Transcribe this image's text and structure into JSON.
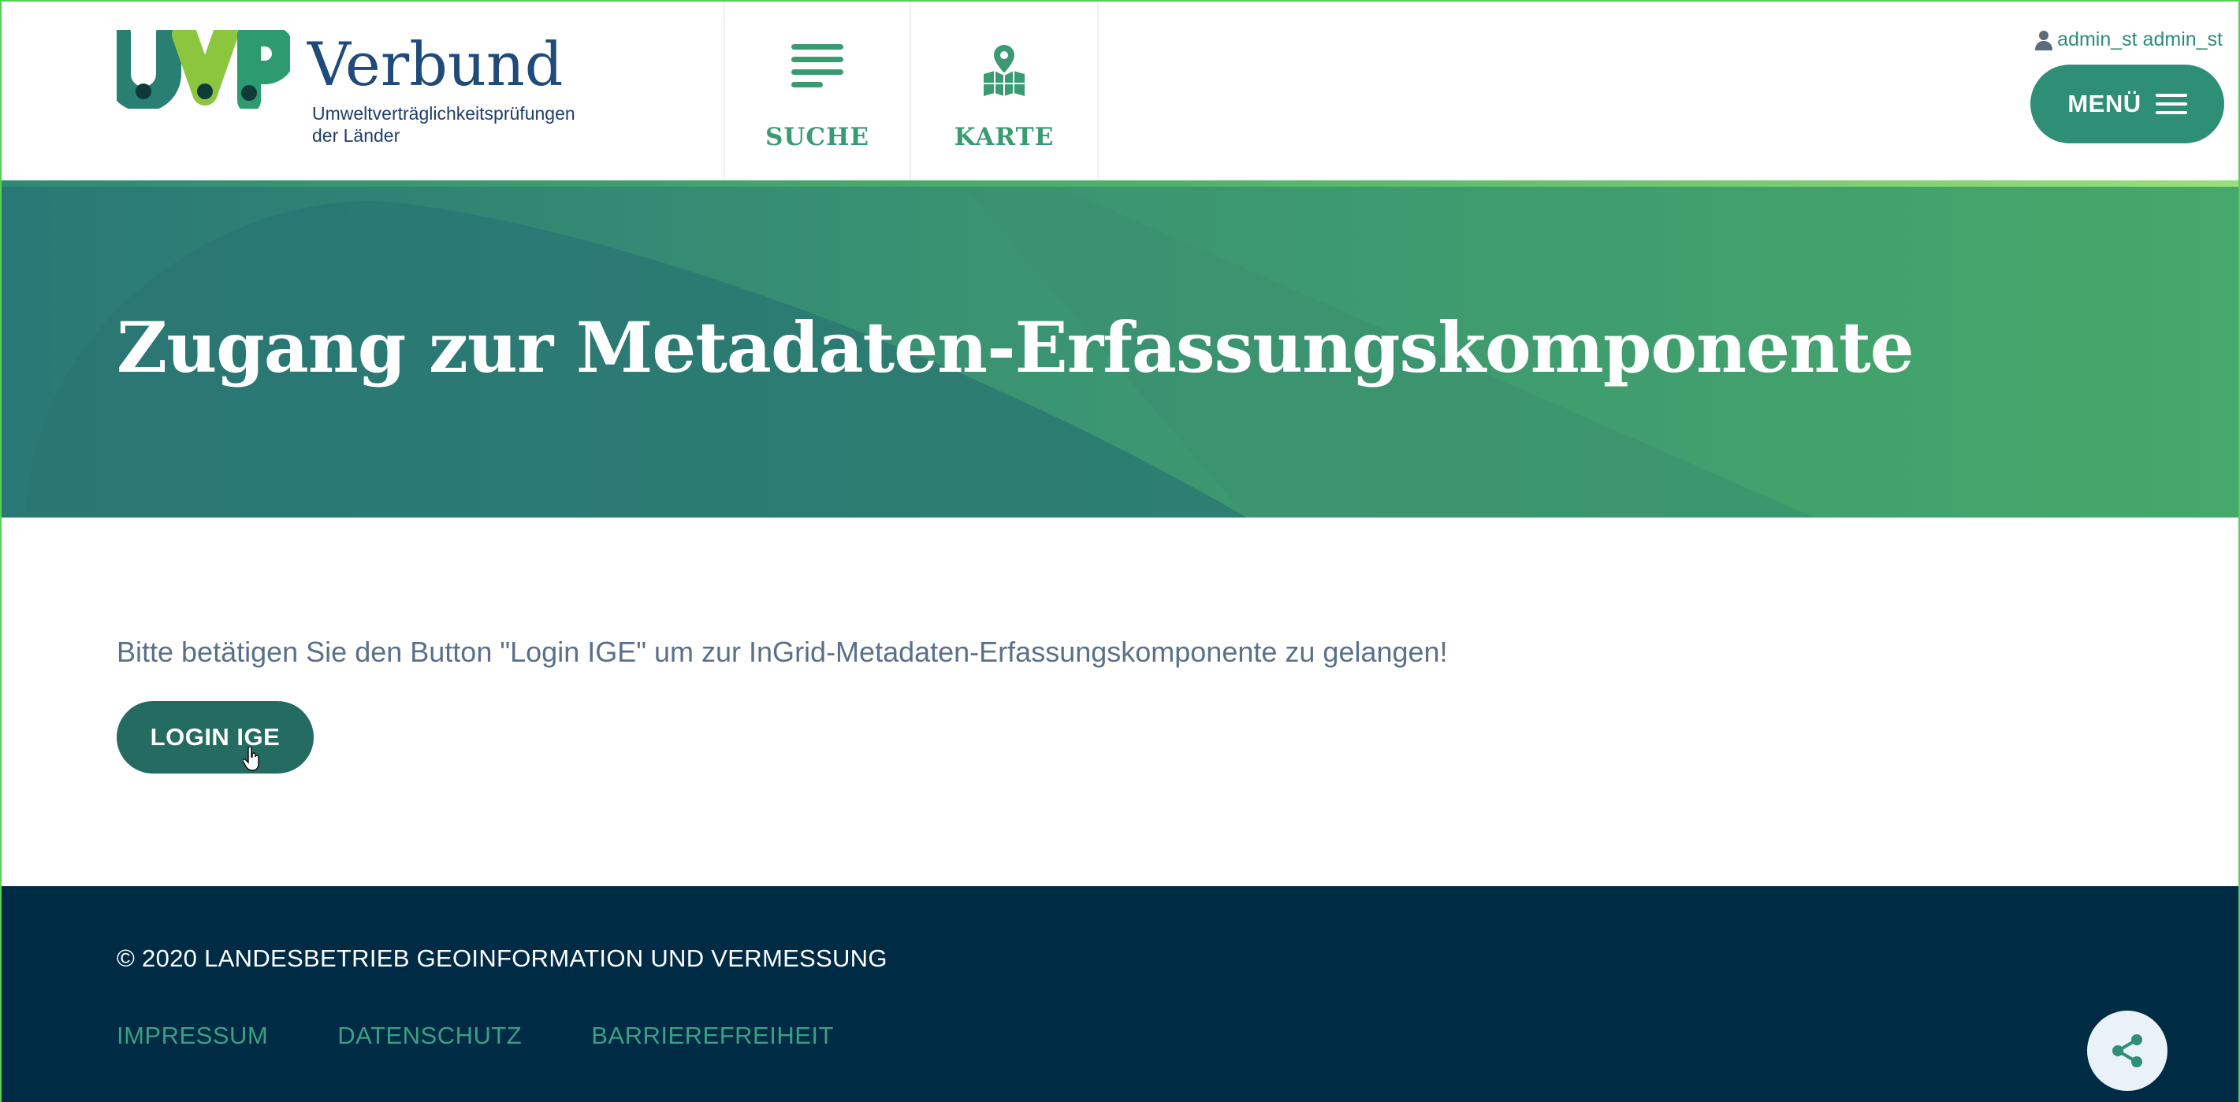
{
  "brand": {
    "wordmark": "Verbund",
    "subtitle_line1": "Umweltverträglichkeitsprüfungen",
    "subtitle_line2": "der Länder",
    "mark_letters": "UVP"
  },
  "nav": {
    "items": [
      {
        "label": "SUCHE",
        "icon": "list-lines-icon"
      },
      {
        "label": "KARTE",
        "icon": "map-pin-icon"
      }
    ],
    "user_label": "admin_st admin_st",
    "menu_label": "MENÜ"
  },
  "hero": {
    "title": "Zugang zur Metadaten-Erfassungskomponente"
  },
  "main": {
    "instruction": "Bitte betätigen Sie den Button \"Login IGE\" um zur InGrid-Metadaten-Erfassungskomponente zu gelangen!",
    "login_label": "LOGIN IGE"
  },
  "footer": {
    "copyright": "© 2020 LANDESBETRIEB GEOINFORMATION UND VERMESSUNG",
    "links": [
      "IMPRESSUM",
      "DATENSCHUTZ",
      "BARRIEREFREIHEIT"
    ]
  },
  "colors": {
    "accent": "#2e8f76",
    "footer_bg": "#002b45",
    "link": "#3aa082",
    "brand_blue": "#1f4a7a"
  }
}
